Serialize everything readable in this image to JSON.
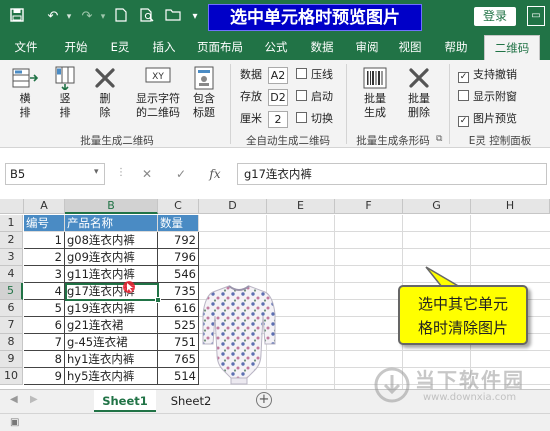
{
  "titlebar": {
    "banner": "选中单元格时预览图片",
    "login": "登录",
    "accent": "#217346",
    "quick_access_icons": [
      "save-icon",
      "undo-icon",
      "redo-icon",
      "new-document-icon",
      "print-preview-icon",
      "open-folder-icon",
      "customize-icon"
    ]
  },
  "tabs": [
    "文件",
    "开始",
    "E灵",
    "插入",
    "页面布局",
    "公式",
    "数据",
    "审阅",
    "视图",
    "帮助",
    "二维码"
  ],
  "active_tab": "二维码",
  "ribbon": {
    "group1": {
      "buttons": [
        "横\n排",
        "竖\n排",
        "删\n除",
        "显示字符\n的二维码",
        "包含\n标题"
      ],
      "label": "批量生成二维码"
    },
    "group2": {
      "rows": [
        {
          "label": "数据",
          "value": "A2",
          "check_label": "压线"
        },
        {
          "label": "存放",
          "value": "D2",
          "check_label": "启动"
        },
        {
          "label": "厘米",
          "value": "2",
          "check_label": "切换"
        }
      ],
      "label": "全自动生成二维码"
    },
    "group3": {
      "buttons": [
        "批量\n生成",
        "批量\n删除"
      ],
      "label": "批量生成条形码"
    },
    "group4": {
      "checks": [
        {
          "label": "支持撤销",
          "checked": true
        },
        {
          "label": "显示附窗",
          "checked": false
        },
        {
          "label": "图片预览",
          "checked": true
        }
      ],
      "label": "E灵 控制面板"
    }
  },
  "formula_bar": {
    "name_box": "B5",
    "fx": "fx",
    "formula": "g17连衣内裤"
  },
  "columns": [
    "A",
    "B",
    "C",
    "D",
    "E",
    "F",
    "G",
    "H"
  ],
  "rows": [
    "1",
    "2",
    "3",
    "4",
    "5",
    "6",
    "7",
    "8",
    "9",
    "10"
  ],
  "table": {
    "headers": [
      "编号",
      "产品名称",
      "数量"
    ],
    "data": [
      [
        "1",
        "g08连衣内裤",
        "792"
      ],
      [
        "2",
        "g09连衣内裤",
        "796"
      ],
      [
        "3",
        "g11连衣内裤",
        "546"
      ],
      [
        "4",
        "g17连衣内裤",
        "735"
      ],
      [
        "5",
        "g19连衣内裤",
        "616"
      ],
      [
        "6",
        "g21连衣裙",
        "525"
      ],
      [
        "7",
        "g-45连衣裙",
        "751"
      ],
      [
        "8",
        "hy1连衣内裤",
        "765"
      ],
      [
        "9",
        "hy5连衣内裤",
        "514"
      ]
    ]
  },
  "callout": {
    "line1": "选中其它单元",
    "line2": "格时清除图片"
  },
  "sheets": [
    "Sheet1",
    "Sheet2"
  ],
  "active_sheet": "Sheet1",
  "watermark": {
    "text": "当下软件园",
    "url": "www.downxia.com"
  }
}
